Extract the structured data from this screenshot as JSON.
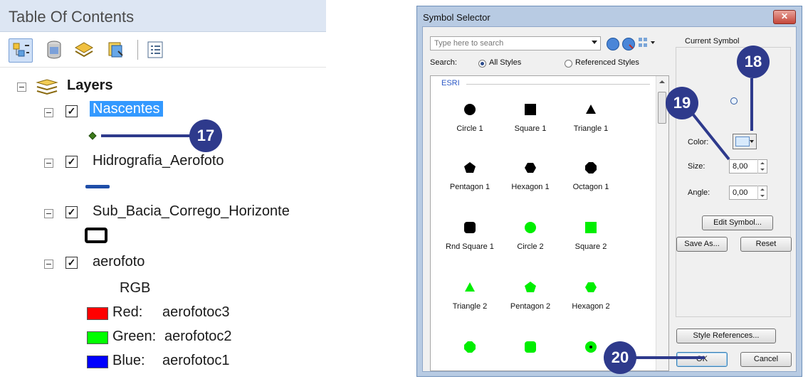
{
  "toc": {
    "title": "Table Of Contents",
    "toolbar": [
      {
        "icon": "list-by-drawing-order-icon"
      },
      {
        "icon": "list-by-source-icon"
      },
      {
        "icon": "list-by-visibility-icon"
      },
      {
        "icon": "list-by-selection-icon"
      },
      {
        "icon": "options-icon"
      }
    ],
    "root_label": "Layers",
    "layers": [
      {
        "name": "Nascentes",
        "checked": true,
        "selected": true,
        "symbol": "green-diamond-point"
      },
      {
        "name": "Hidrografia_Aerofoto",
        "checked": true,
        "symbol": "blue-line"
      },
      {
        "name": "Sub_Bacia_Corrego_Horizonte",
        "checked": true,
        "symbol": "black-outline-polygon"
      },
      {
        "name": "aerofoto",
        "checked": true,
        "symbol": "raster-rgb",
        "rgb_label": "RGB",
        "bands": [
          {
            "channel": "Red:",
            "band": "aerofotoc3",
            "color": "#ff0000"
          },
          {
            "channel": "Green:",
            "band": "aerofotoc2",
            "color": "#00ff00"
          },
          {
            "channel": "Blue:",
            "band": "aerofotoc1",
            "color": "#0000ff"
          }
        ]
      }
    ]
  },
  "callouts": {
    "c17": "17",
    "c18": "18",
    "c19": "19",
    "c20": "20"
  },
  "dialog": {
    "title": "Symbol Selector",
    "close_label": "✕",
    "search_placeholder": "Type here to search",
    "search_label": "Search:",
    "radio_all": "All Styles",
    "radio_referenced": "Referenced Styles",
    "gallery_group": "ESRI",
    "symbols": [
      {
        "label": "Circle 1",
        "shape": "circle",
        "color": "#000000"
      },
      {
        "label": "Square 1",
        "shape": "square",
        "color": "#000000"
      },
      {
        "label": "Triangle 1",
        "shape": "triangle",
        "color": "#000000"
      },
      {
        "label": "Pentagon 1",
        "shape": "pentagon",
        "color": "#000000"
      },
      {
        "label": "Hexagon 1",
        "shape": "hexagon",
        "color": "#000000"
      },
      {
        "label": "Octagon 1",
        "shape": "octagon",
        "color": "#000000"
      },
      {
        "label": "Rnd Square 1",
        "shape": "rndsquare",
        "color": "#000000"
      },
      {
        "label": "Circle 2",
        "shape": "circle",
        "color": "#00ee00"
      },
      {
        "label": "Square 2",
        "shape": "square",
        "color": "#00ee00"
      },
      {
        "label": "Triangle 2",
        "shape": "triangle",
        "color": "#00ee00"
      },
      {
        "label": "Pentagon 2",
        "shape": "pentagon",
        "color": "#00ee00"
      },
      {
        "label": "Hexagon 2",
        "shape": "hexagon",
        "color": "#00ee00"
      },
      {
        "label": "",
        "shape": "octagon",
        "color": "#00ee00"
      },
      {
        "label": "",
        "shape": "rndsquare",
        "color": "#00ee00"
      },
      {
        "label": "",
        "shape": "dotcircle",
        "color": "#00ee00"
      }
    ],
    "current_symbol_title": "Current Symbol",
    "color_label": "Color:",
    "size_label": "Size:",
    "size_value": "8,00",
    "angle_label": "Angle:",
    "angle_value": "0,00",
    "edit_symbol": "Edit Symbol...",
    "save_as": "Save As...",
    "reset": "Reset",
    "style_references": "Style References...",
    "ok": "OK",
    "cancel": "Cancel"
  }
}
